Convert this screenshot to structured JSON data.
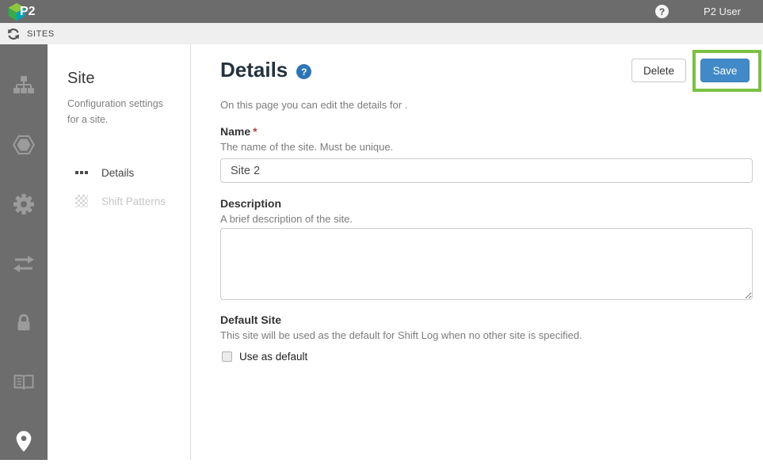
{
  "topbar": {
    "logo_text": "P2",
    "help_glyph": "?",
    "user_label": "P2 User"
  },
  "subbar": {
    "label": "SITES",
    "refresh_icon": "refresh-icon"
  },
  "sidebar": {
    "items": [
      {
        "icon": "hierarchy-icon",
        "active": false
      },
      {
        "icon": "hexagon-icon",
        "active": false
      },
      {
        "icon": "gear-icon",
        "active": false
      },
      {
        "icon": "transfer-arrows-icon",
        "active": false
      },
      {
        "icon": "lock-icon",
        "active": false
      },
      {
        "icon": "book-icon",
        "active": false
      },
      {
        "icon": "location-pin-icon",
        "active": true
      }
    ]
  },
  "panel": {
    "title": "Site",
    "description": "Configuration settings for a site.",
    "nav": [
      {
        "label": "Details",
        "icon": "details-dots-icon",
        "active": true,
        "disabled": false
      },
      {
        "label": "Shift Patterns",
        "icon": "shift-patterns-checker-icon",
        "active": false,
        "disabled": true
      }
    ]
  },
  "main": {
    "title": "Details",
    "help_glyph": "?",
    "subtitle": "On this page you can edit the details for .",
    "buttons": {
      "delete": "Delete",
      "save": "Save"
    },
    "fields": {
      "name": {
        "label": "Name",
        "required_marker": "*",
        "help": "The name of the site. Must be unique.",
        "value": "Site 2"
      },
      "description": {
        "label": "Description",
        "help": "A brief description of the site.",
        "value": ""
      },
      "default_site": {
        "label": "Default Site",
        "help": "This site will be used as the default for Shift Log when no other site is specified.",
        "checkbox_label": "Use as default",
        "checked": false
      }
    }
  },
  "colors": {
    "topbar_gray": "#6c6c6c",
    "sidebar_gray": "#6d6d6d",
    "accent_blue": "#4289c7",
    "help_badge_blue": "#2e75b6",
    "highlight_green": "#7ac142",
    "required_red": "#b5413c",
    "logo_green": "#8dc63f",
    "logo_dark_green": "#39a949",
    "logo_teal": "#00a5b5"
  }
}
